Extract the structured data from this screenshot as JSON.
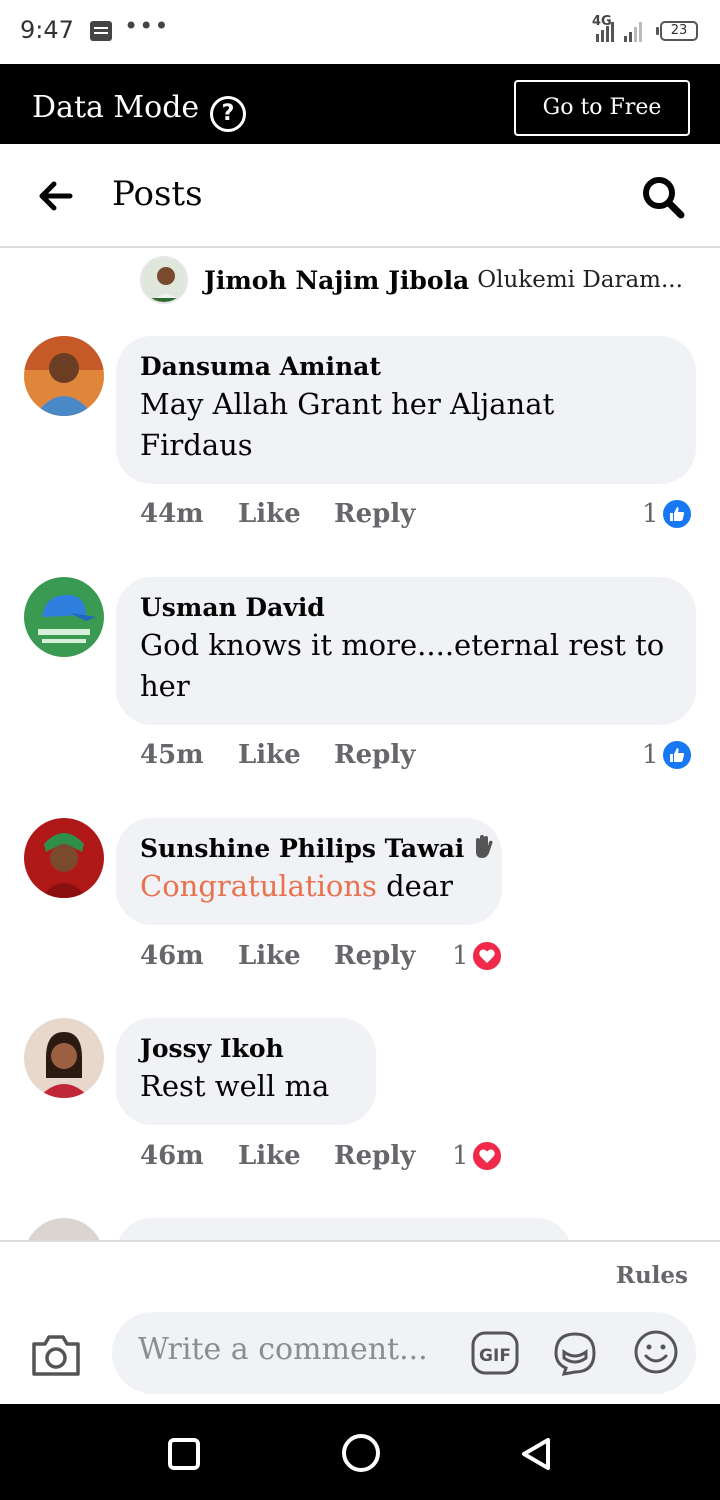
{
  "status_bar": {
    "time": "9:47",
    "network": "4G",
    "battery": "23"
  },
  "data_mode": {
    "title": "Data Mode",
    "help_icon": "?",
    "button_label": "Go to Free"
  },
  "header": {
    "title": "Posts",
    "back_icon": "arrow-left-icon",
    "search_icon": "search-icon"
  },
  "reply_preview": {
    "author": "Jimoh Najim Jibola",
    "text": "Olukemi Daram..."
  },
  "comments": [
    {
      "author": "Dansuma Aminat",
      "text": "May Allah Grant her Aljanat Firdaus",
      "time": "44m",
      "like": "Like",
      "reply": "Reply",
      "reaction_count": "1",
      "reaction": "like"
    },
    {
      "author": "Usman David",
      "text": "God knows it more....eternal rest to her",
      "time": "45m",
      "like": "Like",
      "reply": "Reply",
      "reaction_count": "1",
      "reaction": "like"
    },
    {
      "author": "Sunshine Philips Tawai",
      "text_highlight": "Congratulations",
      "text_rest": " dear",
      "time": "46m",
      "like": "Like",
      "reply": "Reply",
      "reaction_count": "1",
      "reaction": "love"
    },
    {
      "author": "Jossy Ikoh",
      "text": "Rest well ma",
      "time": "46m",
      "like": "Like",
      "reply": "Reply",
      "reaction_count": "1",
      "reaction": "love"
    }
  ],
  "composer": {
    "rules": "Rules",
    "placeholder": "Write a comment...",
    "gif_label": "GIF"
  },
  "colors": {
    "like_blue": "#1877f2",
    "love_red": "#f02849",
    "highlight": "#e9714e",
    "bubble": "#f0f2f5"
  }
}
